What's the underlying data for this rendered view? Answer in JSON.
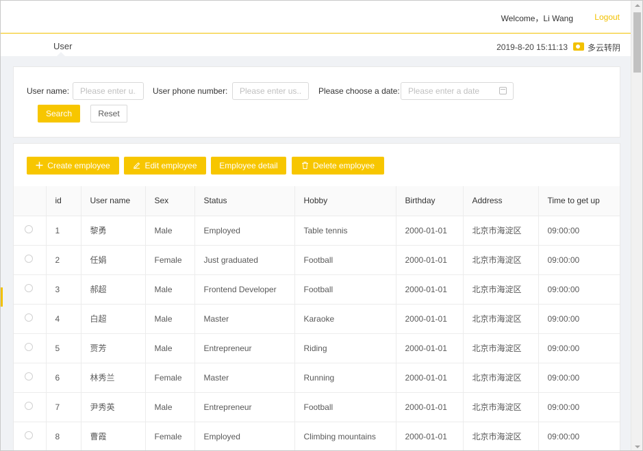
{
  "header": {
    "welcome": "Welcome，Li Wang",
    "logout": "Logout"
  },
  "subheader": {
    "breadcrumb": "User",
    "datetime": "2019-8-20 15:11:13",
    "weather": "多云转阴"
  },
  "search": {
    "username_label": "User name:",
    "username_placeholder": "Please enter u...",
    "phone_label": "User phone number:",
    "phone_placeholder": "Please enter us...",
    "date_label": "Please choose a date:",
    "date_placeholder": "Please enter a date",
    "search_button": "Search",
    "reset_button": "Reset"
  },
  "toolbar": {
    "create": "Create employee",
    "edit": "Edit employee",
    "detail": "Employee detail",
    "delete": "Delete employee"
  },
  "table": {
    "columns": [
      "",
      "id",
      "User name",
      "Sex",
      "Status",
      "Hobby",
      "Birthday",
      "Address",
      "Time to get up"
    ],
    "rows": [
      {
        "id": "1",
        "name": "黎勇",
        "sex": "Male",
        "status": "Employed",
        "hobby": "Table tennis",
        "birthday": "2000-01-01",
        "address": "北京市海淀区",
        "getup": "09:00:00"
      },
      {
        "id": "2",
        "name": "任娟",
        "sex": "Female",
        "status": "Just graduated",
        "hobby": "Football",
        "birthday": "2000-01-01",
        "address": "北京市海淀区",
        "getup": "09:00:00"
      },
      {
        "id": "3",
        "name": "郝超",
        "sex": "Male",
        "status": "Frontend Developer",
        "hobby": "Football",
        "birthday": "2000-01-01",
        "address": "北京市海淀区",
        "getup": "09:00:00"
      },
      {
        "id": "4",
        "name": "白超",
        "sex": "Male",
        "status": "Master",
        "hobby": "Karaoke",
        "birthday": "2000-01-01",
        "address": "北京市海淀区",
        "getup": "09:00:00"
      },
      {
        "id": "5",
        "name": "贾芳",
        "sex": "Male",
        "status": "Entrepreneur",
        "hobby": "Riding",
        "birthday": "2000-01-01",
        "address": "北京市海淀区",
        "getup": "09:00:00"
      },
      {
        "id": "6",
        "name": "林秀兰",
        "sex": "Female",
        "status": "Master",
        "hobby": "Running",
        "birthday": "2000-01-01",
        "address": "北京市海淀区",
        "getup": "09:00:00"
      },
      {
        "id": "7",
        "name": "尹秀英",
        "sex": "Male",
        "status": "Entrepreneur",
        "hobby": "Football",
        "birthday": "2000-01-01",
        "address": "北京市海淀区",
        "getup": "09:00:00"
      },
      {
        "id": "8",
        "name": "曹霞",
        "sex": "Female",
        "status": "Employed",
        "hobby": "Climbing mountains",
        "birthday": "2000-01-01",
        "address": "北京市海淀区",
        "getup": "09:00:00"
      }
    ]
  },
  "colors": {
    "accent": "#f7c600",
    "background": "#f0f2f5"
  },
  "icons": {
    "weather": "weather-cloudy-icon",
    "calendar": "calendar-icon",
    "create": "plus-icon",
    "edit": "edit-pencil-icon",
    "delete": "trash-icon"
  }
}
